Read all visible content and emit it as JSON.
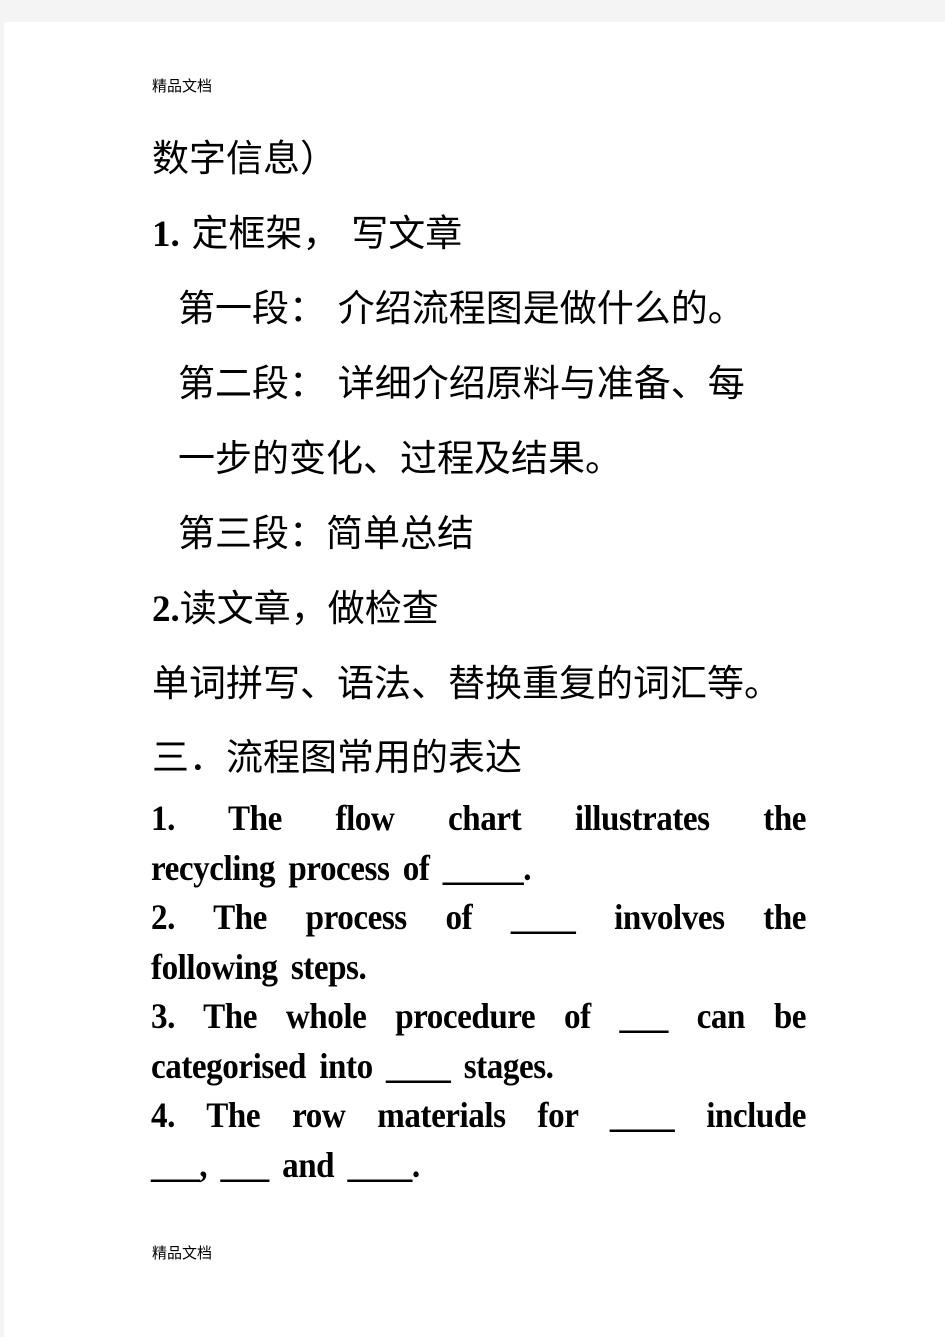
{
  "header": {
    "text": "精品文档"
  },
  "footer": {
    "text": "精品文档"
  },
  "content": {
    "line_intro": "数字信息）",
    "step1": {
      "num": "1.",
      "text": " 定框架，  写文章"
    },
    "para1": "第一段：  介绍流程图是做什么的。",
    "para2_line1": "第二段：  详细介绍原料与准备、每",
    "para2_line2": "一步的变化、过程及结果。",
    "para3": "第三段：简单总结",
    "step2": {
      "num": "2.",
      "text": "读文章，做检查"
    },
    "check_items": "单词拼写、语法、替换重复的词汇等。",
    "section3_title": "三．流程图常用的表达",
    "expressions": [
      {
        "line1": "1. The flow chart illustrates the",
        "line2": "recycling process of _____."
      },
      {
        "line1": "2. The process of ____ involves the",
        "line2": "following steps."
      },
      {
        "line1": "3. The whole procedure of ___ can be",
        "line2": "categorised into ____ stages."
      },
      {
        "line1": "4. The row materials for ____ include",
        "line2": "___, ___ and ____."
      }
    ]
  }
}
